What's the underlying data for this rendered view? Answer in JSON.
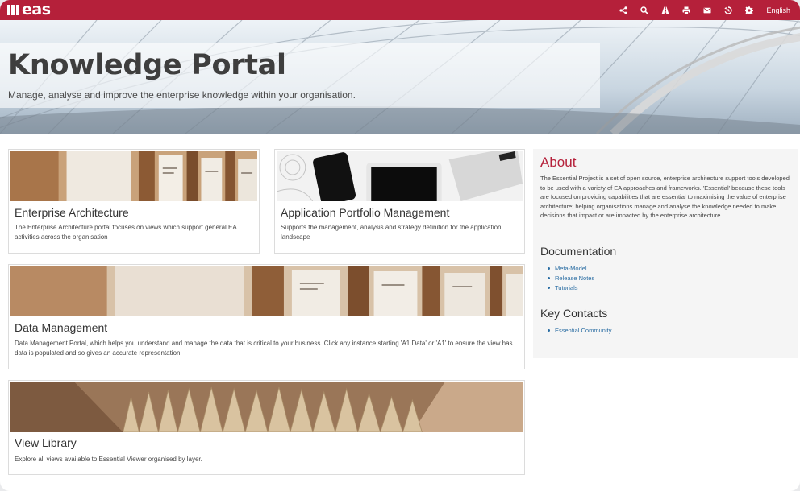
{
  "brand": {
    "logo_text": "eas"
  },
  "toolbar": {
    "icons": [
      "share-icon",
      "search-icon",
      "road-icon",
      "print-icon",
      "envelope-icon",
      "history-icon",
      "gear-icon"
    ],
    "language": "English"
  },
  "hero": {
    "title": "Knowledge Portal",
    "subtitle": "Manage, analyse and improve the enterprise knowledge within your organisation."
  },
  "cards": [
    {
      "title": "Enterprise Architecture",
      "description": "The Enterprise Architecture portal focuses on views which support general EA activities across the organisation"
    },
    {
      "title": "Application Portfolio Management",
      "description": "Supports the management, analysis and strategy definition for the application landscape"
    },
    {
      "title": "Data Management",
      "description": "Data Management Portal, which helps you understand and manage the data that is critical to your business. Click any instance starting 'A1 Data' or 'A1' to ensure the view has data is populated and so gives an accurate representation."
    },
    {
      "title": "View Library",
      "description": "Explore all views available to Essential Viewer organised by layer."
    }
  ],
  "sidebar": {
    "about_title": "About",
    "about_text": "The Essential Project is a set of open source, enterprise architecture support tools developed to be used with a variety of EA approaches and frameworks. 'Essential' because these tools are focused on providing capabilities that are essential to maximising the value of enterprise architecture; helping organisations manage and analyse the knowledge needed to make decisions that impact or are impacted by the enterprise architecture.",
    "documentation_title": "Documentation",
    "documentation_links": [
      "Meta-Model",
      "Release Notes",
      "Tutorials"
    ],
    "contacts_title": "Key Contacts",
    "contact_links": [
      "Essential Community"
    ]
  },
  "colors": {
    "brand": "#b5203a",
    "link": "#2a6da3"
  }
}
